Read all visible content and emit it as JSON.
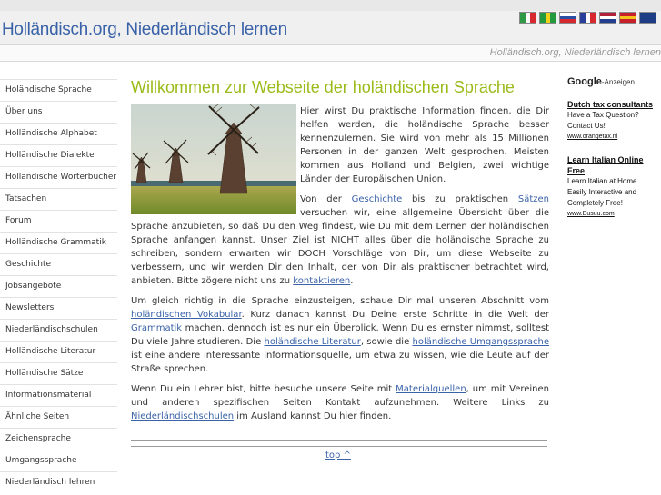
{
  "header": {
    "site_title": "Holländisch.org, Niederländisch lernen",
    "subtitle": "Holländisch.org, Niederländisch lernen",
    "flags": [
      {
        "name": "flag-italy",
        "stripes": [
          "#2e9a45",
          "#ffffff",
          "#d7282f"
        ],
        "orientation": "vertical"
      },
      {
        "name": "flag-brazil",
        "stripes": [
          "#229a3d",
          "#f3d11a",
          "#229a3d"
        ],
        "orientation": "vertical"
      },
      {
        "name": "flag-russia",
        "stripes": [
          "#ffffff",
          "#2a4fa3",
          "#d5282f"
        ],
        "orientation": "horizontal"
      },
      {
        "name": "flag-france",
        "stripes": [
          "#2a3f9c",
          "#ffffff",
          "#d7282f"
        ],
        "orientation": "vertical"
      },
      {
        "name": "flag-netherlands",
        "stripes": [
          "#b0233a",
          "#ffffff",
          "#22408f"
        ],
        "orientation": "horizontal"
      },
      {
        "name": "flag-spain",
        "stripes": [
          "#c8202a",
          "#f3c419",
          "#c8202a"
        ],
        "orientation": "horizontal"
      },
      {
        "name": "flag-uk",
        "stripes": [
          "#1f3d85"
        ],
        "orientation": "horizontal"
      }
    ]
  },
  "sidebar": {
    "items": [
      {
        "label": "Holändische Sprache"
      },
      {
        "label": "Über uns"
      },
      {
        "label": "Holländische Alphabet"
      },
      {
        "label": "Holländische Dialekte"
      },
      {
        "label": "Holländische Wörterbücher"
      },
      {
        "label": "Tatsachen"
      },
      {
        "label": "Forum"
      },
      {
        "label": "Holländische Grammatik"
      },
      {
        "label": "Geschichte"
      },
      {
        "label": "Jobsangebote"
      },
      {
        "label": "Newsletters"
      },
      {
        "label": "Niederländischschulen"
      },
      {
        "label": "Holländische Literatur"
      },
      {
        "label": "Holländische Sätze"
      },
      {
        "label": "Informationsmaterial"
      },
      {
        "label": "Ähnliche Seiten"
      },
      {
        "label": "Zeichensprache"
      },
      {
        "label": "Umgangssprache"
      },
      {
        "label": "Niederländisch lehren"
      }
    ]
  },
  "main": {
    "heading": "Willkommen zur Webseite der holändischen Sprache",
    "p1": "Hier wirst Du praktische Information finden, die Dir helfen werden, die holändische Sprache besser kennenzulernen. Sie wird von mehr als 15 Millionen Personen in der ganzen Welt gesprochen. Meisten kommen aus Holland und Belgien, zwei wichtige Länder der Europäischen Union.",
    "p2_a": "Von der ",
    "p2_link1": "Geschichte",
    "p2_b": " bis zu praktischen ",
    "p2_link2": "Sätzen",
    "p2_c": " versuchen wir, eine allgemeine Übersicht über die Sprache anzubieten, so daß Du den Weg findest, wie Du mit dem Lernen der holändischen Sprache anfangen kannst. Unser Ziel ist NICHT alles über die holändische Sprache zu schreiben, sondern erwarten wir DOCH Vorschläge von Dir, um diese Webseite zu verbessern, und wir werden Dir den Inhalt, der von Dir als praktischer betrachtet wird, anbieten. Bitte zögere nicht uns zu ",
    "p2_link3": "kontaktieren",
    "p2_d": ".",
    "p3_a": "Um gleich richtig in die Sprache einzusteigen, schaue Dir mal unseren Abschnitt vom ",
    "p3_link1": "holändischen Vokabular",
    "p3_b": ". Kurz danach kannst Du Deine erste Schritte in die Welt der ",
    "p3_link2": "Grammatik",
    "p3_c": " machen. dennoch ist es nur ein Überblick. Wenn Du es ernster nimmst, solltest Du viele Jahre studieren. Die ",
    "p3_link3": "holändische Literatur",
    "p3_d": ", sowie die ",
    "p3_link4": "holändische Umgangssprache",
    "p3_e": " ist eine andere interessante Informationsquelle, um etwa zu wissen, wie die Leute auf der Straße sprechen.",
    "p4_a": "Wenn Du ein Lehrer bist, bitte besuche unsere Seite mit ",
    "p4_link1": "Materialquellen",
    "p4_b": ", um mit Vereinen und anderen spezifischen Seiten Kontakt aufzunehmen. Weitere Links zu ",
    "p4_link2": "Niederländischschulen",
    "p4_c": " im Ausland kannst Du hier finden.",
    "top_link": "top ^"
  },
  "ads": {
    "google": "Google",
    "label": "-Anzeigen",
    "items": [
      {
        "title": "Dutch tax consultants",
        "lines": [
          "Have a Tax Question?",
          "Contact Us!"
        ],
        "url": "www.orangetax.nl"
      },
      {
        "title": "Learn Italian Online Free",
        "lines": [
          "Learn Italian at Home",
          "Easily Interactive and",
          "Completely Free!"
        ],
        "url": "www.Busuu.com"
      }
    ]
  },
  "colors": {
    "title_blue": "#3a62a8",
    "heading_green": "#9bbb1a",
    "link_blue": "#3a62a8"
  }
}
